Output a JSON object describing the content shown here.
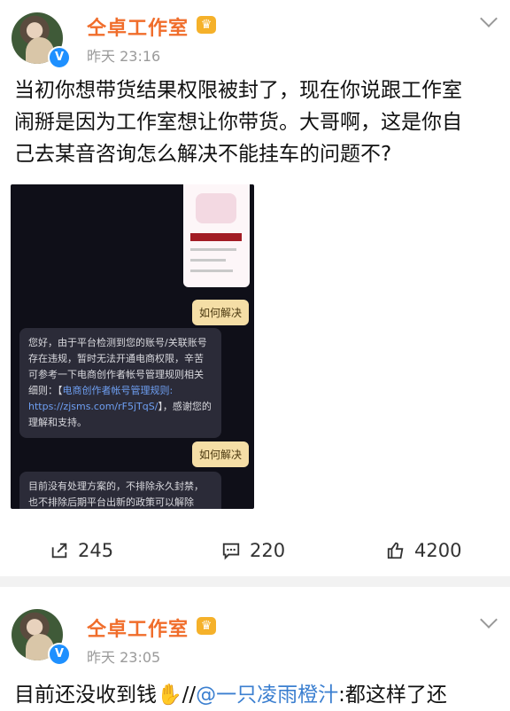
{
  "posts": [
    {
      "author": "仝卓工作室",
      "time": "昨天 23:16",
      "text_line1": "当初你想带货结果权限被封了，现在你说跟工作室",
      "text_line2": "闹掰是因为工作室想让你带货。大哥啊，这是你自",
      "text_line3": "己去某音咨询怎么解决不能挂车的问题不?",
      "screenshot": {
        "button1": "如何解决",
        "reply1": "您好，由于平台检测到您的账号/关联账号存在违规，暂时无法开通电商权限，辛苦可参考一下电商创作者帐号管理规则相关细则：【",
        "reply1_link_text": "电商创作者帐号管理规则:",
        "reply1_url": "https://zjsms.com/rF5jTqS/",
        "reply1_tail": "】，感谢您的理解和支持。",
        "button2": "如何解决",
        "reply2": "目前没有处理方案的，不排除永久封禁，也不排除后期平台出新的政策可以解除"
      },
      "actions": {
        "repost": "245",
        "comment": "220",
        "like": "4200"
      }
    },
    {
      "author": "仝卓工作室",
      "time": "昨天 23:05",
      "text_start": "目前还没收到钱",
      "text_sep": "//",
      "mention": "@一只凌雨橙汁",
      "text_end": ":都这样了还"
    }
  ],
  "icons": {
    "badge": "verified-v-icon",
    "crown": "member-crown-icon",
    "menu": "chevron-down-icon",
    "repost": "share-icon",
    "comment": "comment-icon",
    "like": "thumbs-up-icon",
    "emoji": "hand-emoji-icon"
  },
  "colors": {
    "name": "#f06d2b",
    "link": "#3b7fd0",
    "verified": "#1e90ff"
  }
}
